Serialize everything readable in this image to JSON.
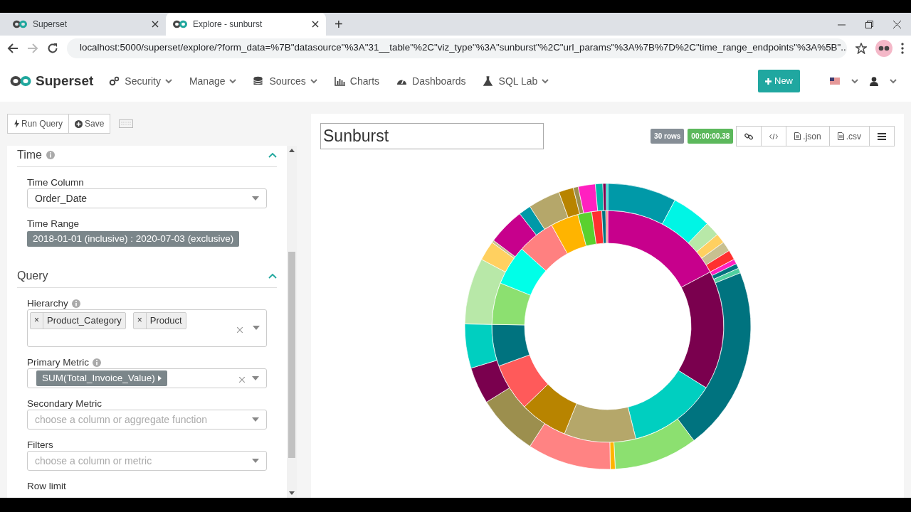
{
  "browser": {
    "tabs": [
      {
        "title": "Superset",
        "selected": false
      },
      {
        "title": "Explore - sunburst",
        "selected": true
      }
    ],
    "new_tab": "+",
    "url": "localhost:5000/superset/explore/?form_data=%7B\"datasource\"%3A\"31__table\"%2C\"viz_type\"%3A\"sunburst\"%2C\"url_params\"%3A%7B%7D%2C\"time_range_endpoints\"%3A%5B\"..."
  },
  "navbar": {
    "brand": "Superset",
    "menu": [
      {
        "label": "Security",
        "dropdown": true
      },
      {
        "label": "Manage",
        "dropdown": true
      },
      {
        "label": "Sources",
        "dropdown": true
      },
      {
        "label": "Charts",
        "dropdown": false
      },
      {
        "label": "Dashboards",
        "dropdown": false
      },
      {
        "label": "SQL Lab",
        "dropdown": true
      }
    ],
    "new_button": "New"
  },
  "toolbar": {
    "buttons": [
      {
        "label": "Run Query"
      },
      {
        "label": "Save"
      }
    ]
  },
  "sections": [
    {
      "title": "Time",
      "info": true,
      "expanded": true,
      "controls": [
        {
          "kind": "select",
          "label": "Time Column",
          "info": false,
          "value": "Order_Date"
        },
        {
          "kind": "range",
          "label": "Time Range",
          "info": false,
          "value": "2018-01-01 (inclusive) : 2020-07-03 (exclusive)"
        }
      ]
    },
    {
      "title": "Query",
      "info": false,
      "expanded": true,
      "controls": [
        {
          "kind": "tags",
          "label": "Hierarchy",
          "info": true,
          "tags": [
            {
              "label": "Product_Category",
              "remove": "×"
            },
            {
              "label": "Product",
              "remove": "×"
            }
          ]
        },
        {
          "kind": "metric",
          "label": "Primary Metric",
          "info": true,
          "value": "SUM(Total_Invoice_Value)"
        },
        {
          "kind": "select",
          "label": "Secondary Metric",
          "info": false,
          "placeholder": "choose a column or aggregate function"
        },
        {
          "kind": "select",
          "label": "Filters",
          "info": false,
          "placeholder": "choose a column or metric"
        },
        {
          "kind": "label",
          "label": "Row limit",
          "info": false
        }
      ]
    }
  ],
  "chart": {
    "title": "Sunburst",
    "row_count": "30 rows",
    "duration": "00:00:00.38",
    "actions": [
      {
        "kind": "link"
      },
      {
        "kind": "code"
      },
      {
        "kind": "file",
        "label": ".json"
      },
      {
        "kind": "file",
        "label": ".csv"
      },
      {
        "kind": "menu"
      }
    ]
  }
}
